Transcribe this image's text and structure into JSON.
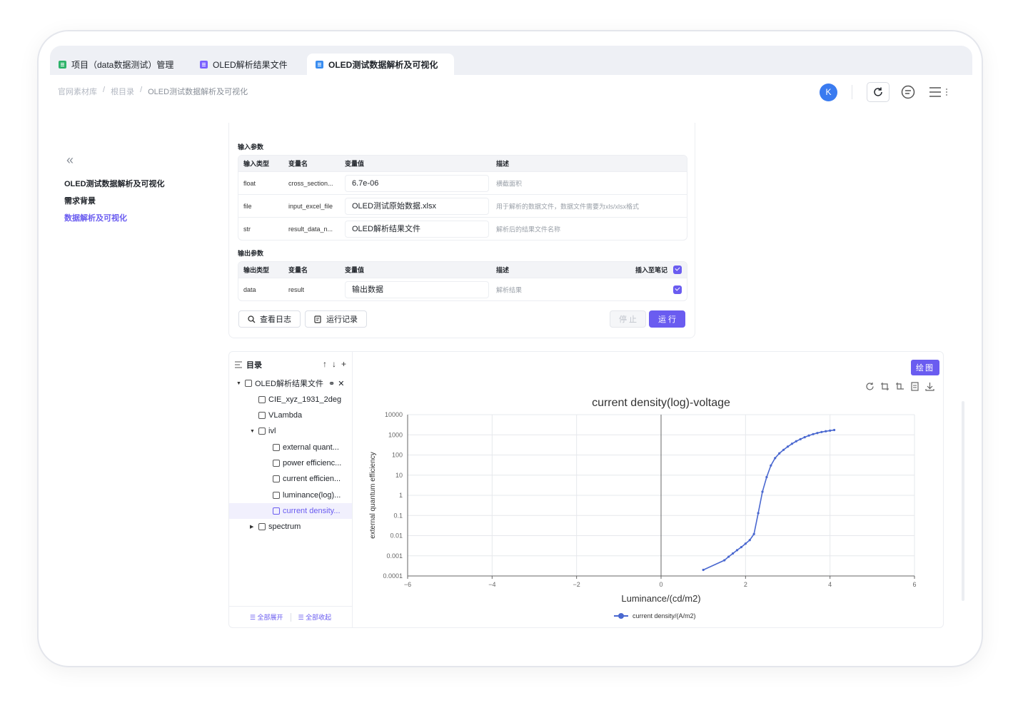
{
  "tabs": [
    {
      "label": "项目（data数据测试）管理",
      "icon": "table-icon",
      "color": "#2fb36b"
    },
    {
      "label": "OLED解析结果文件",
      "icon": "file-icon",
      "color": "#7b61ff"
    },
    {
      "label": "OLED测试数据解析及可视化",
      "icon": "notebook-icon",
      "color": "#3a8df0"
    }
  ],
  "breadcrumb": [
    "官网素材库",
    "/",
    "根目录",
    "/",
    "OLED测试数据解析及可视化"
  ],
  "user": {
    "avatar_letter": "K"
  },
  "sidebar": {
    "items": [
      {
        "label": "OLED测试数据解析及可视化"
      },
      {
        "label": "需求背景"
      },
      {
        "label": "数据解析及可视化"
      }
    ]
  },
  "inputs": {
    "title": "输入参数",
    "headers": [
      "输入类型",
      "变量名",
      "变量值",
      "描述"
    ],
    "rows": [
      {
        "type": "float",
        "name": "cross_section...",
        "value": "6.7e-06",
        "desc": "横截面积"
      },
      {
        "type": "file",
        "name": "input_excel_file",
        "value": "OLED测试原始数据.xlsx",
        "desc": "用于解析的数据文件，数据文件需要为xls/xlsx格式"
      },
      {
        "type": "str",
        "name": "result_data_n...",
        "value": "OLED解析结果文件",
        "desc": "解析后的结果文件名称"
      }
    ]
  },
  "outputs": {
    "title": "输出参数",
    "headers": [
      "输出类型",
      "变量名",
      "变量值",
      "描述",
      "插入至笔记"
    ],
    "rows": [
      {
        "type": "data",
        "name": "result",
        "value": "输出数据",
        "desc": "解析结果"
      }
    ]
  },
  "actions": {
    "log": "查看日志",
    "history": "运行记录",
    "stop": "停 止",
    "run": "运 行"
  },
  "tree": {
    "title": "目录",
    "root": "OLED解析结果文件",
    "nodes": [
      "CIE_xyz_1931_2deg",
      "VLambda",
      "ivl",
      "external quant...",
      "power efficienc...",
      "current efficien...",
      "luminance(log)...",
      "current density...",
      "spectrum"
    ],
    "expand_all": "全部展开",
    "collapse_all": "全部收起"
  },
  "plot_button": "绘图",
  "chart_data": {
    "type": "line",
    "title": "current density(log)-voltage",
    "xlabel": "Luminance/(cd/m2)",
    "ylabel": "external quantum efficiency",
    "xlim": [
      -6,
      6
    ],
    "xticks": [
      "−6",
      "−4",
      "−2",
      "0",
      "2",
      "4",
      "6"
    ],
    "ylim": [
      0.0001,
      10000
    ],
    "yscale": "log",
    "yticks": [
      "10000",
      "1000",
      "100",
      "10",
      "1",
      "0.1",
      "0.01",
      "0.001",
      "0.0001"
    ],
    "grid": true,
    "legend": "bottom-center",
    "color": "#4a68d0",
    "series": [
      {
        "name": "current density/(A/m2)",
        "x": [
          1.0,
          1.5,
          1.6,
          1.7,
          1.8,
          1.9,
          2.0,
          2.1,
          2.2,
          2.3,
          2.4,
          2.5,
          2.6,
          2.7,
          2.8,
          2.9,
          3.0,
          3.1,
          3.2,
          3.3,
          3.4,
          3.5,
          3.6,
          3.7,
          3.8,
          3.9,
          4.0,
          4.1
        ],
        "y": [
          0.0002,
          0.0006,
          0.0009,
          0.0013,
          0.0019,
          0.0027,
          0.004,
          0.006,
          0.012,
          0.13,
          1.5,
          8,
          30,
          70,
          120,
          180,
          260,
          360,
          480,
          610,
          760,
          920,
          1080,
          1230,
          1380,
          1500,
          1620,
          1730
        ]
      }
    ]
  }
}
